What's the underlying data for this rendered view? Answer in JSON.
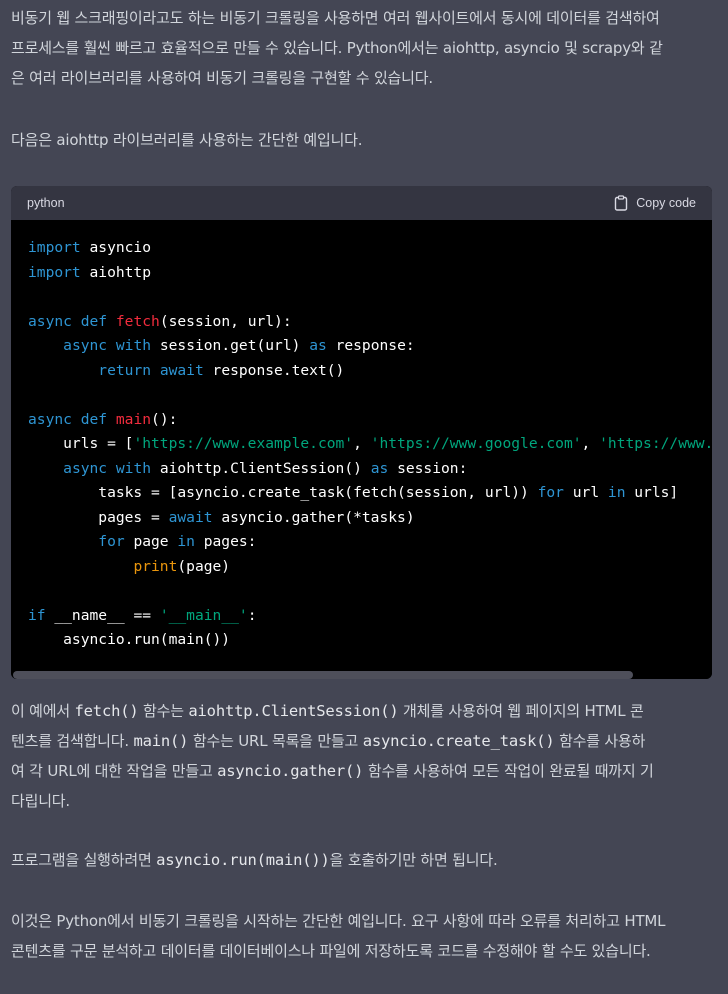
{
  "intro": {
    "lines": [
      "비동기 웹 스크래핑이라고도 하는 비동기 크롤링을 사용하면 여러 웹사이트에서 동시에 데이터를 검색하여",
      "프로세스를 훨씬 빠르고 효율적으로 만들 수 있습니다. Python에서는 aiohttp, asyncio 및 scrapy와 같",
      "은 여러 라이브러리를 사용하여 비동기 크롤링을 구현할 수 있습니다."
    ]
  },
  "example_intro": "다음은 aiohttp 라이브러리를 사용하는 간단한 예입니다.",
  "code_block": {
    "language": "python",
    "copy_label": "Copy code",
    "copy_icon": "clipboard-icon",
    "lines": [
      [
        {
          "t": "import",
          "c": "kw"
        },
        {
          "t": " asyncio"
        }
      ],
      [
        {
          "t": "import",
          "c": "kw"
        },
        {
          "t": " aiohttp"
        }
      ],
      [],
      [
        {
          "t": "async",
          "c": "kw"
        },
        {
          "t": " "
        },
        {
          "t": "def",
          "c": "kw"
        },
        {
          "t": " "
        },
        {
          "t": "fetch",
          "c": "fn"
        },
        {
          "t": "(session, url):"
        }
      ],
      [
        {
          "t": "    "
        },
        {
          "t": "async",
          "c": "kw"
        },
        {
          "t": " "
        },
        {
          "t": "with",
          "c": "kw"
        },
        {
          "t": " session.get(url) "
        },
        {
          "t": "as",
          "c": "kw"
        },
        {
          "t": " response:"
        }
      ],
      [
        {
          "t": "        "
        },
        {
          "t": "return",
          "c": "kw"
        },
        {
          "t": " "
        },
        {
          "t": "await",
          "c": "kw"
        },
        {
          "t": " response.text()"
        }
      ],
      [],
      [
        {
          "t": "async",
          "c": "kw"
        },
        {
          "t": " "
        },
        {
          "t": "def",
          "c": "kw"
        },
        {
          "t": " "
        },
        {
          "t": "main",
          "c": "fn"
        },
        {
          "t": "():"
        }
      ],
      [
        {
          "t": "    urls = ["
        },
        {
          "t": "'https://www.example.com'",
          "c": "st"
        },
        {
          "t": ", "
        },
        {
          "t": "'https://www.google.com'",
          "c": "st"
        },
        {
          "t": ", "
        },
        {
          "t": "'https://www.amaz",
          "c": "st"
        }
      ],
      [
        {
          "t": "    "
        },
        {
          "t": "async",
          "c": "kw"
        },
        {
          "t": " "
        },
        {
          "t": "with",
          "c": "kw"
        },
        {
          "t": " aiohttp.ClientSession() "
        },
        {
          "t": "as",
          "c": "kw"
        },
        {
          "t": " session:"
        }
      ],
      [
        {
          "t": "        tasks = [asyncio.create_task(fetch(session, url)) "
        },
        {
          "t": "for",
          "c": "kw"
        },
        {
          "t": " url "
        },
        {
          "t": "in",
          "c": "kw"
        },
        {
          "t": " urls]"
        }
      ],
      [
        {
          "t": "        pages = "
        },
        {
          "t": "await",
          "c": "kw"
        },
        {
          "t": " asyncio.gather(*tasks)"
        }
      ],
      [
        {
          "t": "        "
        },
        {
          "t": "for",
          "c": "kw"
        },
        {
          "t": " page "
        },
        {
          "t": "in",
          "c": "kw"
        },
        {
          "t": " pages:"
        }
      ],
      [
        {
          "t": "            "
        },
        {
          "t": "print",
          "c": "bi"
        },
        {
          "t": "(page)"
        }
      ],
      [],
      [
        {
          "t": "if",
          "c": "kw"
        },
        {
          "t": " __name__ == "
        },
        {
          "t": "'__main__'",
          "c": "st"
        },
        {
          "t": ":"
        }
      ],
      [
        {
          "t": "    asyncio.run(main())"
        }
      ]
    ]
  },
  "explanation": {
    "lines": [
      [
        {
          "t": "이 예에서 "
        },
        {
          "t": "fetch()",
          "code": true
        },
        {
          "t": " 함수는 "
        },
        {
          "t": "aiohttp.ClientSession()",
          "code": true
        },
        {
          "t": " 개체를 사용하여 웹 페이지의 HTML 콘"
        }
      ],
      [
        {
          "t": "텐츠를 검색합니다. "
        },
        {
          "t": "main()",
          "code": true
        },
        {
          "t": " 함수는 URL 목록을 만들고 "
        },
        {
          "t": "asyncio.create_task()",
          "code": true
        },
        {
          "t": " 함수를 사용하"
        }
      ],
      [
        {
          "t": "여 각 URL에 대한 작업을 만들고 "
        },
        {
          "t": "asyncio.gather()",
          "code": true
        },
        {
          "t": " 함수를 사용하여 모든 작업이 완료될 때까지 기"
        }
      ],
      [
        {
          "t": "다립니다."
        }
      ]
    ]
  },
  "run_note": [
    {
      "t": "프로그램을 실행하려면 "
    },
    {
      "t": "asyncio.run(main())",
      "code": true
    },
    {
      "t": "을 호출하기만 하면 됩니다."
    }
  ],
  "closing": {
    "lines": [
      "이것은 Python에서 비동기 크롤링을 시작하는 간단한 예입니다. 요구 사항에 따라 오류를 처리하고 HTML",
      "콘텐츠를 구문 분석하고 데이터를 데이터베이스나 파일에 저장하도록 코드를 수정해야 할 수도 있습니다."
    ]
  },
  "colors": {
    "background": "#444654",
    "text": "#d1d5db",
    "code_bg": "#000000",
    "code_header_bg": "#343541",
    "keyword": "#2e95d3",
    "function": "#f22c3d",
    "string": "#00a67d",
    "builtin": "#e9950c"
  }
}
